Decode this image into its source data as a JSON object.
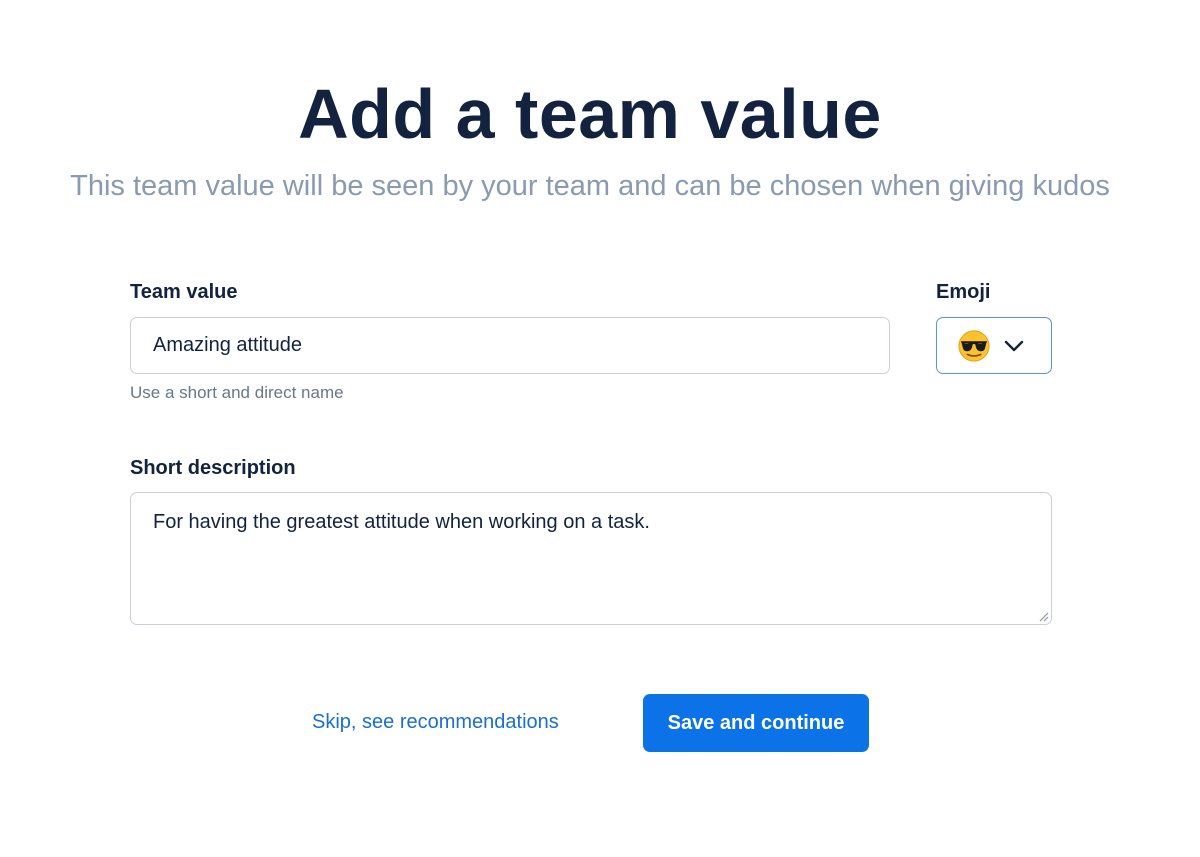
{
  "header": {
    "title": "Add a team value",
    "subtitle": "This team value will be seen by your team and can be chosen when giving kudos"
  },
  "form": {
    "team_value": {
      "label": "Team value",
      "value": "Amazing attitude",
      "hint": "Use a short and direct name"
    },
    "emoji": {
      "label": "Emoji",
      "selected_icon": "sunglasses-face-icon",
      "dropdown_icon": "chevron-down-icon"
    },
    "description": {
      "label": "Short description",
      "value": "For having the greatest attitude when working on a task."
    }
  },
  "actions": {
    "skip_label": "Skip, see recommendations",
    "save_label": "Save and continue"
  },
  "colors": {
    "title": "#13223f",
    "subtitle": "#8a9ab0",
    "primary": "#0b72e7",
    "link": "#1a6fd1",
    "input_border": "#c9d0dc",
    "focus_border": "#5c94e0"
  }
}
